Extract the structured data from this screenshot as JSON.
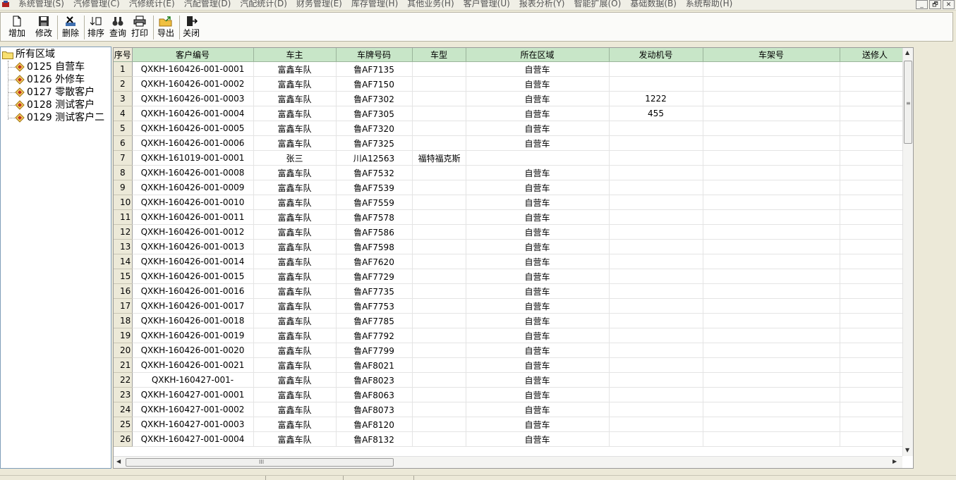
{
  "menubar": {
    "items": [
      "系统管理(S)",
      "汽修管理(C)",
      "汽修统计(E)",
      "汽配管理(D)",
      "汽配统计(D)",
      "财务管理(E)",
      "库存管理(H)",
      "其他业务(H)",
      "客户管理(U)",
      "报表分析(Y)",
      "智能扩展(O)",
      "基础数据(B)",
      "系统帮助(H)"
    ],
    "window_buttons": [
      "_",
      "🗗",
      "✕"
    ]
  },
  "toolbar": {
    "add": "增加",
    "edit": "修改",
    "delete": "删除",
    "sort": "排序",
    "query": "查询",
    "print": "打印",
    "export": "导出",
    "close": "关闭"
  },
  "tree": {
    "root": "所有区域",
    "items": [
      "0125 自营车",
      "0126 外修车",
      "0127 零散客户",
      "0128 测试客户",
      "0129 测试客户二"
    ]
  },
  "grid": {
    "columns": [
      "序号",
      "客户编号",
      "车主",
      "车牌号码",
      "车型",
      "所在区域",
      "发动机号",
      "车架号",
      "送修人"
    ],
    "rows": [
      {
        "no": "1",
        "code": "QXKH-160426-001-0001",
        "owner": "富鑫车队",
        "plate": "鲁AF7135",
        "model": "",
        "area": "自营车",
        "engine": "",
        "frame": "",
        "sender": ""
      },
      {
        "no": "2",
        "code": "QXKH-160426-001-0002",
        "owner": "富鑫车队",
        "plate": "鲁AF7150",
        "model": "",
        "area": "自营车",
        "engine": "",
        "frame": "",
        "sender": ""
      },
      {
        "no": "3",
        "code": "QXKH-160426-001-0003",
        "owner": "富鑫车队",
        "plate": "鲁AF7302",
        "model": "",
        "area": "自营车",
        "engine": "1222",
        "frame": "",
        "sender": ""
      },
      {
        "no": "4",
        "code": "QXKH-160426-001-0004",
        "owner": "富鑫车队",
        "plate": "鲁AF7305",
        "model": "",
        "area": "自营车",
        "engine": "455",
        "frame": "",
        "sender": ""
      },
      {
        "no": "5",
        "code": "QXKH-160426-001-0005",
        "owner": "富鑫车队",
        "plate": "鲁AF7320",
        "model": "",
        "area": "自营车",
        "engine": "",
        "frame": "",
        "sender": ""
      },
      {
        "no": "6",
        "code": "QXKH-160426-001-0006",
        "owner": "富鑫车队",
        "plate": "鲁AF7325",
        "model": "",
        "area": "自营车",
        "engine": "",
        "frame": "",
        "sender": ""
      },
      {
        "no": "7",
        "code": "QXKH-161019-001-0001",
        "owner": "张三",
        "plate": "川A12563",
        "model": "福特福克斯",
        "area": "",
        "engine": "",
        "frame": "",
        "sender": ""
      },
      {
        "no": "8",
        "code": "QXKH-160426-001-0008",
        "owner": "富鑫车队",
        "plate": "鲁AF7532",
        "model": "",
        "area": "自营车",
        "engine": "",
        "frame": "",
        "sender": ""
      },
      {
        "no": "9",
        "code": "QXKH-160426-001-0009",
        "owner": "富鑫车队",
        "plate": "鲁AF7539",
        "model": "",
        "area": "自营车",
        "engine": "",
        "frame": "",
        "sender": ""
      },
      {
        "no": "10",
        "code": "QXKH-160426-001-0010",
        "owner": "富鑫车队",
        "plate": "鲁AF7559",
        "model": "",
        "area": "自营车",
        "engine": "",
        "frame": "",
        "sender": ""
      },
      {
        "no": "11",
        "code": "QXKH-160426-001-0011",
        "owner": "富鑫车队",
        "plate": "鲁AF7578",
        "model": "",
        "area": "自营车",
        "engine": "",
        "frame": "",
        "sender": ""
      },
      {
        "no": "12",
        "code": "QXKH-160426-001-0012",
        "owner": "富鑫车队",
        "plate": "鲁AF7586",
        "model": "",
        "area": "自营车",
        "engine": "",
        "frame": "",
        "sender": ""
      },
      {
        "no": "13",
        "code": "QXKH-160426-001-0013",
        "owner": "富鑫车队",
        "plate": "鲁AF7598",
        "model": "",
        "area": "自营车",
        "engine": "",
        "frame": "",
        "sender": ""
      },
      {
        "no": "14",
        "code": "QXKH-160426-001-0014",
        "owner": "富鑫车队",
        "plate": "鲁AF7620",
        "model": "",
        "area": "自营车",
        "engine": "",
        "frame": "",
        "sender": ""
      },
      {
        "no": "15",
        "code": "QXKH-160426-001-0015",
        "owner": "富鑫车队",
        "plate": "鲁AF7729",
        "model": "",
        "area": "自营车",
        "engine": "",
        "frame": "",
        "sender": ""
      },
      {
        "no": "16",
        "code": "QXKH-160426-001-0016",
        "owner": "富鑫车队",
        "plate": "鲁AF7735",
        "model": "",
        "area": "自营车",
        "engine": "",
        "frame": "",
        "sender": ""
      },
      {
        "no": "17",
        "code": "QXKH-160426-001-0017",
        "owner": "富鑫车队",
        "plate": "鲁AF7753",
        "model": "",
        "area": "自营车",
        "engine": "",
        "frame": "",
        "sender": ""
      },
      {
        "no": "18",
        "code": "QXKH-160426-001-0018",
        "owner": "富鑫车队",
        "plate": "鲁AF7785",
        "model": "",
        "area": "自营车",
        "engine": "",
        "frame": "",
        "sender": ""
      },
      {
        "no": "19",
        "code": "QXKH-160426-001-0019",
        "owner": "富鑫车队",
        "plate": "鲁AF7792",
        "model": "",
        "area": "自营车",
        "engine": "",
        "frame": "",
        "sender": ""
      },
      {
        "no": "20",
        "code": "QXKH-160426-001-0020",
        "owner": "富鑫车队",
        "plate": "鲁AF7799",
        "model": "",
        "area": "自营车",
        "engine": "",
        "frame": "",
        "sender": ""
      },
      {
        "no": "21",
        "code": "QXKH-160426-001-0021",
        "owner": "富鑫车队",
        "plate": "鲁AF8021",
        "model": "",
        "area": "自营车",
        "engine": "",
        "frame": "",
        "sender": ""
      },
      {
        "no": "22",
        "code": "QXKH-160427-001-",
        "owner": "富鑫车队",
        "plate": "鲁AF8023",
        "model": "",
        "area": "自营车",
        "engine": "",
        "frame": "",
        "sender": ""
      },
      {
        "no": "23",
        "code": "QXKH-160427-001-0001",
        "owner": "富鑫车队",
        "plate": "鲁AF8063",
        "model": "",
        "area": "自营车",
        "engine": "",
        "frame": "",
        "sender": ""
      },
      {
        "no": "24",
        "code": "QXKH-160427-001-0002",
        "owner": "富鑫车队",
        "plate": "鲁AF8073",
        "model": "",
        "area": "自营车",
        "engine": "",
        "frame": "",
        "sender": ""
      },
      {
        "no": "25",
        "code": "QXKH-160427-001-0003",
        "owner": "富鑫车队",
        "plate": "鲁AF8120",
        "model": "",
        "area": "自营车",
        "engine": "",
        "frame": "",
        "sender": ""
      },
      {
        "no": "26",
        "code": "QXKH-160427-001-0004",
        "owner": "富鑫车队",
        "plate": "鲁AF8132",
        "model": "",
        "area": "自营车",
        "engine": "",
        "frame": "",
        "sender": ""
      }
    ]
  },
  "scroll": {
    "up_arrow": "▲",
    "down_arrow": "▼",
    "left_arrow": "◀",
    "right_arrow": "▶",
    "v_grip": "≡",
    "h_grip": "III"
  }
}
